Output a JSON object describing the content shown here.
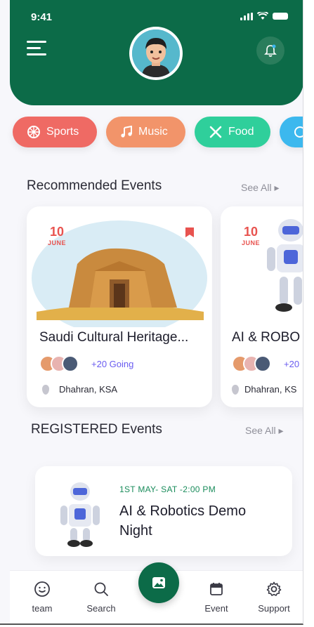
{
  "status_bar": {
    "time": "9:41"
  },
  "header": {
    "menu_icon": "menu-icon",
    "avatar": "user-avatar",
    "notification_icon": "bell-icon"
  },
  "categories": [
    {
      "label": "Sports",
      "icon": "ball-icon",
      "color": "#ef6a64"
    },
    {
      "label": "Music",
      "icon": "music-note-icon",
      "color": "#f2946a"
    },
    {
      "label": "Food",
      "icon": "utensils-icon",
      "color": "#2fcf9b"
    },
    {
      "label": "",
      "icon": "more-category-icon",
      "color": "#3cb8ee"
    }
  ],
  "recommended": {
    "title": "Recommended Events",
    "see_all": "See All ▸",
    "events": [
      {
        "day": "10",
        "month": "JUNE",
        "title": "Saudi Cultural Heritage...",
        "going": "+20 Going",
        "location": "Dhahran, KSA"
      },
      {
        "day": "10",
        "month": "JUNE",
        "title": "AI & ROBO",
        "going": "+20",
        "location": "Dhahran, KS"
      }
    ]
  },
  "registered": {
    "title": "REGISTERED Events",
    "see_all": "See All ▸",
    "event": {
      "datetime": "1ST MAY- SAT -2:00 PM",
      "title": "AI & Robotics Demo Night"
    }
  },
  "bottom_nav": [
    {
      "label": "team",
      "icon": "smiley-icon"
    },
    {
      "label": "Search",
      "icon": "search-icon"
    },
    {
      "label": "",
      "icon": "gallery-icon"
    },
    {
      "label": "Event",
      "icon": "calendar-icon"
    },
    {
      "label": "Support",
      "icon": "gear-icon"
    }
  ],
  "colors": {
    "primary": "#0c6b48",
    "accent_red": "#e8534f",
    "going_purple": "#6a5cf0"
  }
}
